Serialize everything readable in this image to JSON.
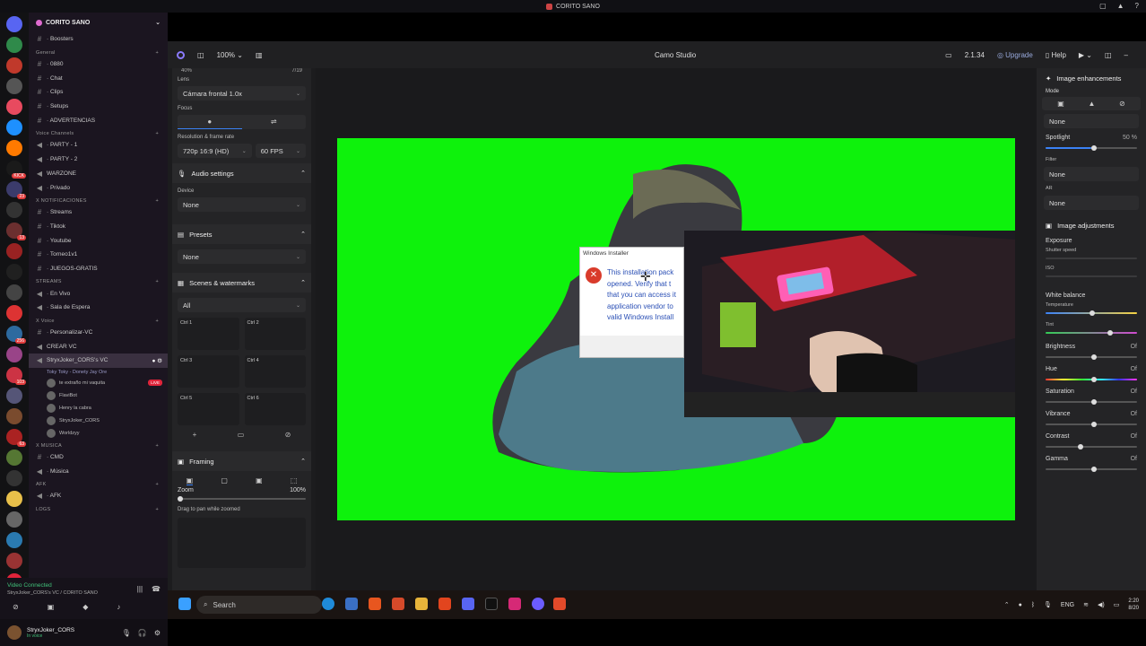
{
  "window": {
    "title": "CORITO SANO"
  },
  "discord": {
    "server_name": "CORITO SANO",
    "channels": [
      {
        "type": "text",
        "label": "· Boosters"
      },
      {
        "type": "category",
        "label": "General"
      },
      {
        "type": "text",
        "label": "· 0880"
      },
      {
        "type": "text",
        "label": "· Chat"
      },
      {
        "type": "text",
        "label": "· Clips"
      },
      {
        "type": "text",
        "label": "· Setups"
      },
      {
        "type": "text",
        "label": "· ADVERTENCIAS"
      },
      {
        "type": "category",
        "label": "Voice Channels"
      },
      {
        "type": "voice",
        "label": "· PARTY - 1"
      },
      {
        "type": "voice",
        "label": "· PARTY - 2"
      },
      {
        "type": "voice",
        "label": "WARZONE"
      },
      {
        "type": "voice",
        "label": "· Privado"
      },
      {
        "type": "category",
        "label": "X NOTIFICACIONES"
      },
      {
        "type": "text",
        "label": "· Streams"
      },
      {
        "type": "text",
        "label": "· Tiktok"
      },
      {
        "type": "text",
        "label": "· Youtube"
      },
      {
        "type": "text",
        "label": "· Torneo1v1"
      },
      {
        "type": "text",
        "label": "· JUEGOS-GRATIS"
      },
      {
        "type": "category",
        "label": "STREAMS"
      },
      {
        "type": "voice",
        "label": "· En Vivo"
      },
      {
        "type": "voice",
        "label": "· Sala de Espera"
      },
      {
        "type": "category",
        "label": "X Voice"
      },
      {
        "type": "text",
        "label": "· Personalizar-VC"
      },
      {
        "type": "voice",
        "label": "CREAR VC"
      },
      {
        "type": "voice-active",
        "label": "StryxJoker_CORS's VC",
        "status": "Toky Toky - Donety Jay Ore"
      }
    ],
    "vc_users": [
      {
        "name": "te extraño mi vaquita",
        "live": true
      },
      {
        "name": "FlaviBot",
        "live": false
      },
      {
        "name": "Henry la cabra",
        "live": false
      },
      {
        "name": "StryxJoker_CORS",
        "live": false
      },
      {
        "name": "Worldzyy",
        "live": false
      }
    ],
    "channels2": [
      {
        "type": "category",
        "label": "X MUSICA"
      },
      {
        "type": "text",
        "label": "· CMD"
      },
      {
        "type": "voice",
        "label": "· Música"
      },
      {
        "type": "category",
        "label": "AFK"
      },
      {
        "type": "voice",
        "label": "· AFK"
      },
      {
        "type": "category",
        "label": "LOGS"
      }
    ],
    "live_label": "LIVE",
    "voice_status": "Video Connected",
    "voice_sub": "StryxJoker_CORS's VC / CORITO SANO",
    "user": {
      "name": "StryxJoker_CORS",
      "status": "In voice"
    },
    "servers": [
      {
        "color": "#5865f2",
        "badge": ""
      },
      {
        "color": "#2f8a4a",
        "badge": ""
      },
      {
        "color": "#c0392b",
        "badge": ""
      },
      {
        "color": "#555555",
        "badge": ""
      },
      {
        "color": "#e84a5f",
        "badge": ""
      },
      {
        "color": "#1e90ff",
        "badge": ""
      },
      {
        "color": "#ff7a00",
        "badge": ""
      },
      {
        "color": "#1a1a1a",
        "badge": "KICK"
      },
      {
        "color": "#3b3b6b",
        "badge": "23"
      },
      {
        "color": "#333333",
        "badge": ""
      },
      {
        "color": "#6b2f2f",
        "badge": "13"
      },
      {
        "color": "#992222",
        "badge": ""
      },
      {
        "color": "#202020",
        "badge": ""
      },
      {
        "color": "#444444",
        "badge": ""
      },
      {
        "color": "#dd3333",
        "badge": ""
      },
      {
        "color": "#2d6a9f",
        "badge": "256"
      },
      {
        "color": "#994488",
        "badge": ""
      },
      {
        "color": "#cc3344",
        "badge": "103"
      },
      {
        "color": "#555577",
        "badge": ""
      },
      {
        "color": "#7a4b2e",
        "badge": ""
      },
      {
        "color": "#aa2222",
        "badge": "63"
      },
      {
        "color": "#557733",
        "badge": ""
      },
      {
        "color": "#333333",
        "badge": ""
      },
      {
        "color": "#e8c04a",
        "badge": ""
      },
      {
        "color": "#666666",
        "badge": ""
      },
      {
        "color": "#2a7ab0",
        "badge": ""
      },
      {
        "color": "#993333",
        "badge": ""
      },
      {
        "color": "#e0243a",
        "badge": "NEW"
      }
    ]
  },
  "camo": {
    "title": "Camo Studio",
    "zoom": "100%",
    "version": "2.1.34",
    "upgrade": "Upgrade",
    "help": "Help",
    "left": {
      "top_val_left": "40%",
      "top_val_right": "7/19",
      "lens_label": "Lens",
      "lens_value": "Cámara frontal 1.0x",
      "focus_label": "Focus",
      "resfr_label": "Resolution & frame rate",
      "resolution": "720p 16:9 (HD)",
      "fps": "60 FPS",
      "audio_title": "Audio settings",
      "device_label": "Device",
      "device_value": "None",
      "presets_title": "Presets",
      "presets_value": "None",
      "scenes_title": "Scenes & watermarks",
      "scenes_filter": "All",
      "scenes": [
        "Ctrl 1",
        "Ctrl 2",
        "Ctrl 3",
        "Ctrl 4",
        "Ctrl 5",
        "Ctrl 6"
      ],
      "framing_title": "Framing",
      "zoom_label": "Zoom",
      "zoom_value": "100%",
      "zoom_fraction": 0.0,
      "drag_hint": "Drag to pan while zoomed"
    },
    "right": {
      "enh_title": "Image enhancements",
      "mode_label": "Mode",
      "mode_value": "None",
      "spotlight_label": "Spotlight",
      "spotlight_value": "50 %",
      "spotlight_fraction": 0.5,
      "filter_label": "Filter",
      "filter_value": "None",
      "ar_label": "AR",
      "ar_value": "None",
      "adj_title": "Image adjustments",
      "exposure_label": "Exposure",
      "shutter_label": "Shutter speed",
      "iso_label": "ISO",
      "wb_label": "White balance",
      "temp_label": "Temperature",
      "tint_label": "Tint",
      "sliders": [
        {
          "label": "Brightness",
          "value": "Of",
          "fraction": 0.5
        },
        {
          "label": "Hue",
          "value": "Of",
          "fraction": 0.5
        },
        {
          "label": "Saturation",
          "value": "Of",
          "fraction": 0.5
        },
        {
          "label": "Vibrance",
          "value": "Of",
          "fraction": 0.5
        },
        {
          "label": "Contrast",
          "value": "Of",
          "fraction": 0.35
        },
        {
          "label": "Gamma",
          "value": "Of",
          "fraction": 0.5
        }
      ]
    }
  },
  "installer": {
    "title": "Windows Installer",
    "message": "This installation pack\nopened. Verify that t\nthat you can access it\napplication vendor to\nvalid Windows Install"
  },
  "taskbar": {
    "search_placeholder": "Search",
    "lang": "ENG",
    "time": "2:20",
    "date": "8/20"
  }
}
